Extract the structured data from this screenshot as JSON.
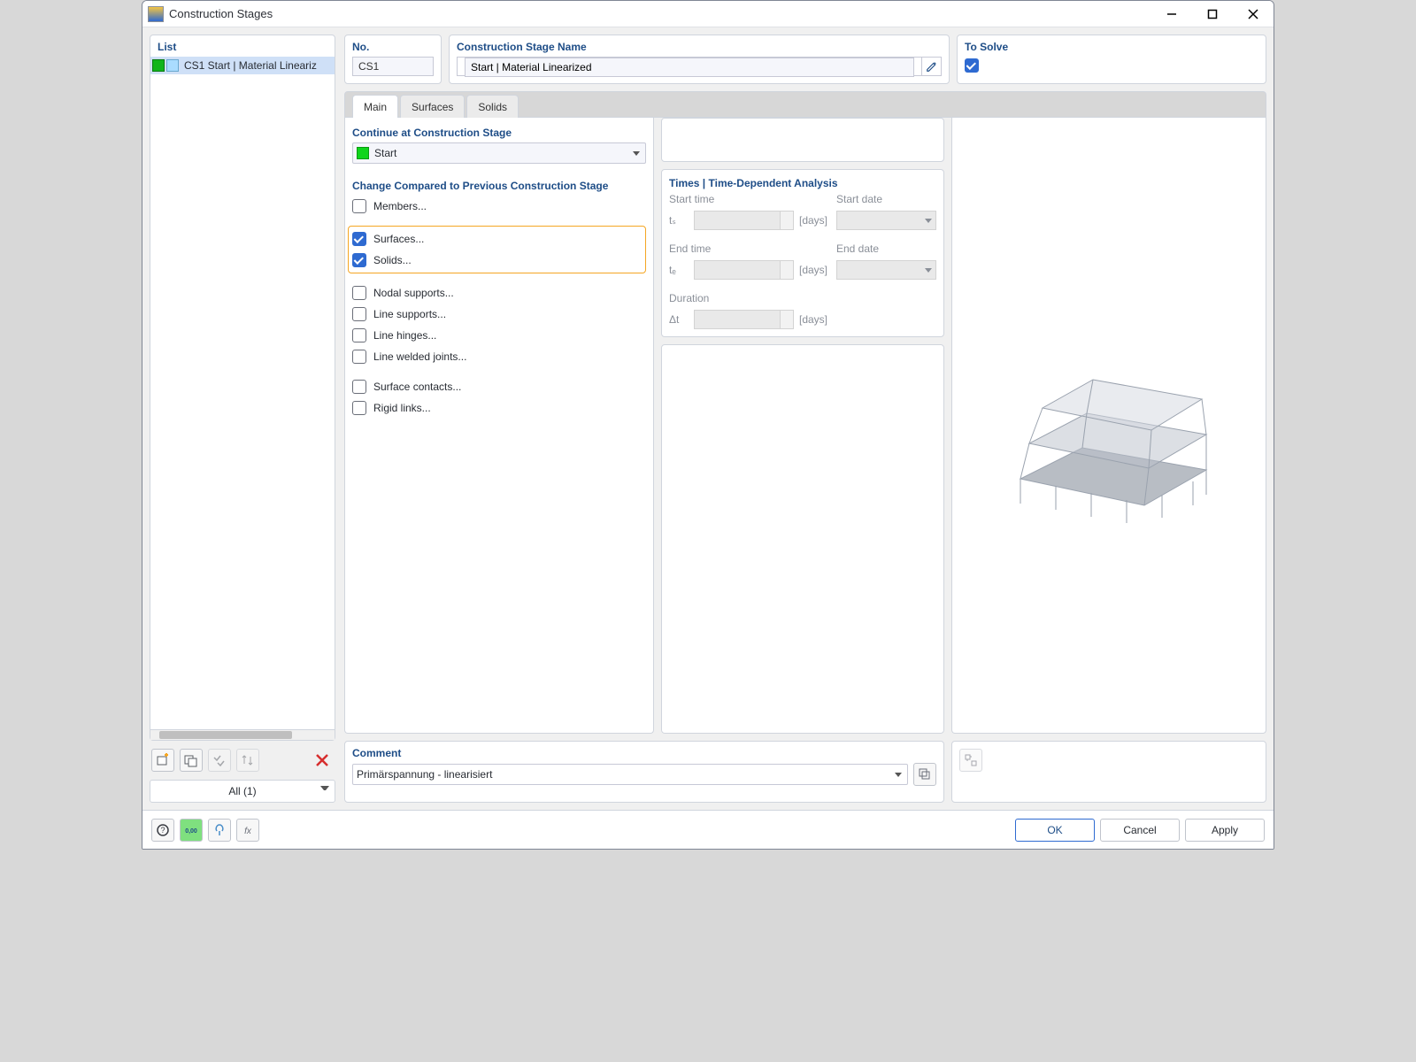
{
  "window": {
    "title": "Construction Stages"
  },
  "left": {
    "list_title": "List",
    "items": [
      {
        "label": "CS1  Start | Material Lineariz"
      }
    ],
    "filter_label": "All (1)"
  },
  "top": {
    "no_title": "No.",
    "no_value": "CS1",
    "name_title": "Construction Stage Name",
    "name_value": "Start | Material Linearized",
    "to_solve_title": "To Solve",
    "to_solve_checked": true
  },
  "tabs": {
    "main": "Main",
    "surfaces": "Surfaces",
    "solids": "Solids"
  },
  "main_tab": {
    "continue_title": "Continue at Construction Stage",
    "continue_value": "Start",
    "change_title": "Change Compared to Previous Construction Stage",
    "checks": {
      "members": "Members...",
      "surfaces": "Surfaces...",
      "solids": "Solids...",
      "nodal_supports": "Nodal supports...",
      "line_supports": "Line supports...",
      "line_hinges": "Line hinges...",
      "line_welded": "Line welded joints...",
      "surface_contacts": "Surface contacts...",
      "rigid_links": "Rigid links..."
    }
  },
  "time": {
    "title": "Times | Time-Dependent Analysis",
    "start_time": "Start time",
    "start_date": "Start date",
    "ts": "tₛ",
    "end_time": "End time",
    "end_date": "End date",
    "te": "tₑ",
    "duration": "Duration",
    "dt": "Δt",
    "days": "[days]"
  },
  "comment": {
    "title": "Comment",
    "value": "Primärspannung - linearisiert"
  },
  "buttons": {
    "ok": "OK",
    "cancel": "Cancel",
    "apply": "Apply"
  }
}
